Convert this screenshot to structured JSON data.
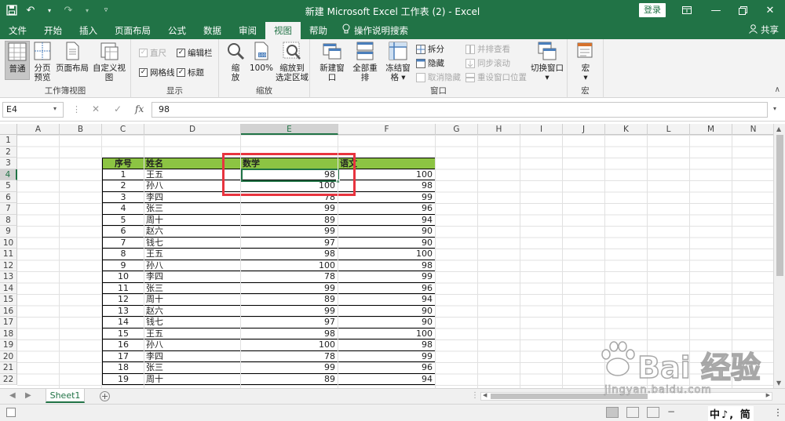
{
  "titlebar": {
    "title": "新建 Microsoft Excel 工作表 (2)  -  Excel",
    "login_label": "登录"
  },
  "tabs": [
    "文件",
    "开始",
    "插入",
    "页面布局",
    "公式",
    "数据",
    "审阅",
    "视图",
    "帮助"
  ],
  "active_tab": "视图",
  "tell_me": "操作说明搜索",
  "share": "共享",
  "ribbon": {
    "workbook_views": {
      "label": "工作簿视图",
      "normal": "普通",
      "page_break": "分页\n预览",
      "page_layout": "页面布局",
      "custom": "自定义视图"
    },
    "show": {
      "label": "显示",
      "ruler": "直尺",
      "gridlines": "网格线",
      "formula_bar": "编辑栏",
      "headings": "标题"
    },
    "zoom": {
      "label": "缩放",
      "zoom": "缩\n放",
      "zoom100": "100%",
      "zoom_selection": "缩放到\n选定区域"
    },
    "window": {
      "label": "窗口",
      "new_window": "新建窗口",
      "arrange_all": "全部重排",
      "freeze": "冻结窗格",
      "split": "拆分",
      "hide": "隐藏",
      "unhide": "取消隐藏",
      "side_by_side": "并排查看",
      "sync_scroll": "同步滚动",
      "reset_position": "重设窗口位置",
      "switch": "切换窗口"
    },
    "macros": {
      "label": "宏",
      "macros": "宏"
    }
  },
  "formula_bar": {
    "name_box": "E4",
    "value": "98",
    "fx": "fx"
  },
  "columns": [
    "A",
    "B",
    "C",
    "D",
    "E",
    "F",
    "G",
    "H",
    "I",
    "J",
    "K",
    "L",
    "M",
    "N"
  ],
  "rows": [
    "1",
    "2",
    "3",
    "4",
    "5",
    "6",
    "7",
    "8",
    "9",
    "10",
    "11",
    "12",
    "13",
    "14",
    "15",
    "16",
    "17",
    "18",
    "19",
    "20",
    "21",
    "22"
  ],
  "table": {
    "headers": [
      "序号",
      "姓名",
      "数学",
      "语文"
    ],
    "rows": [
      [
        "1",
        "王五",
        "98",
        "100"
      ],
      [
        "2",
        "孙八",
        "100",
        "98"
      ],
      [
        "3",
        "李四",
        "78",
        "99"
      ],
      [
        "4",
        "张三",
        "99",
        "96"
      ],
      [
        "5",
        "周十",
        "89",
        "94"
      ],
      [
        "6",
        "赵六",
        "99",
        "90"
      ],
      [
        "7",
        "钱七",
        "97",
        "90"
      ],
      [
        "8",
        "王五",
        "98",
        "100"
      ],
      [
        "9",
        "孙八",
        "100",
        "98"
      ],
      [
        "10",
        "李四",
        "78",
        "99"
      ],
      [
        "11",
        "张三",
        "99",
        "96"
      ],
      [
        "12",
        "周十",
        "89",
        "94"
      ],
      [
        "13",
        "赵六",
        "99",
        "90"
      ],
      [
        "14",
        "钱七",
        "97",
        "90"
      ],
      [
        "15",
        "王五",
        "98",
        "100"
      ],
      [
        "16",
        "孙八",
        "100",
        "98"
      ],
      [
        "17",
        "李四",
        "78",
        "99"
      ],
      [
        "18",
        "张三",
        "99",
        "96"
      ],
      [
        "19",
        "周十",
        "89",
        "94"
      ]
    ]
  },
  "sheet_tab": "Sheet1",
  "ime": "中♪, 简",
  "watermark": {
    "text": "Bai 经验",
    "sub": "jingyan.baidu.com"
  },
  "colors": {
    "brand": "#217346",
    "header_fill": "#8cc443",
    "highlight": "#e8343f"
  }
}
